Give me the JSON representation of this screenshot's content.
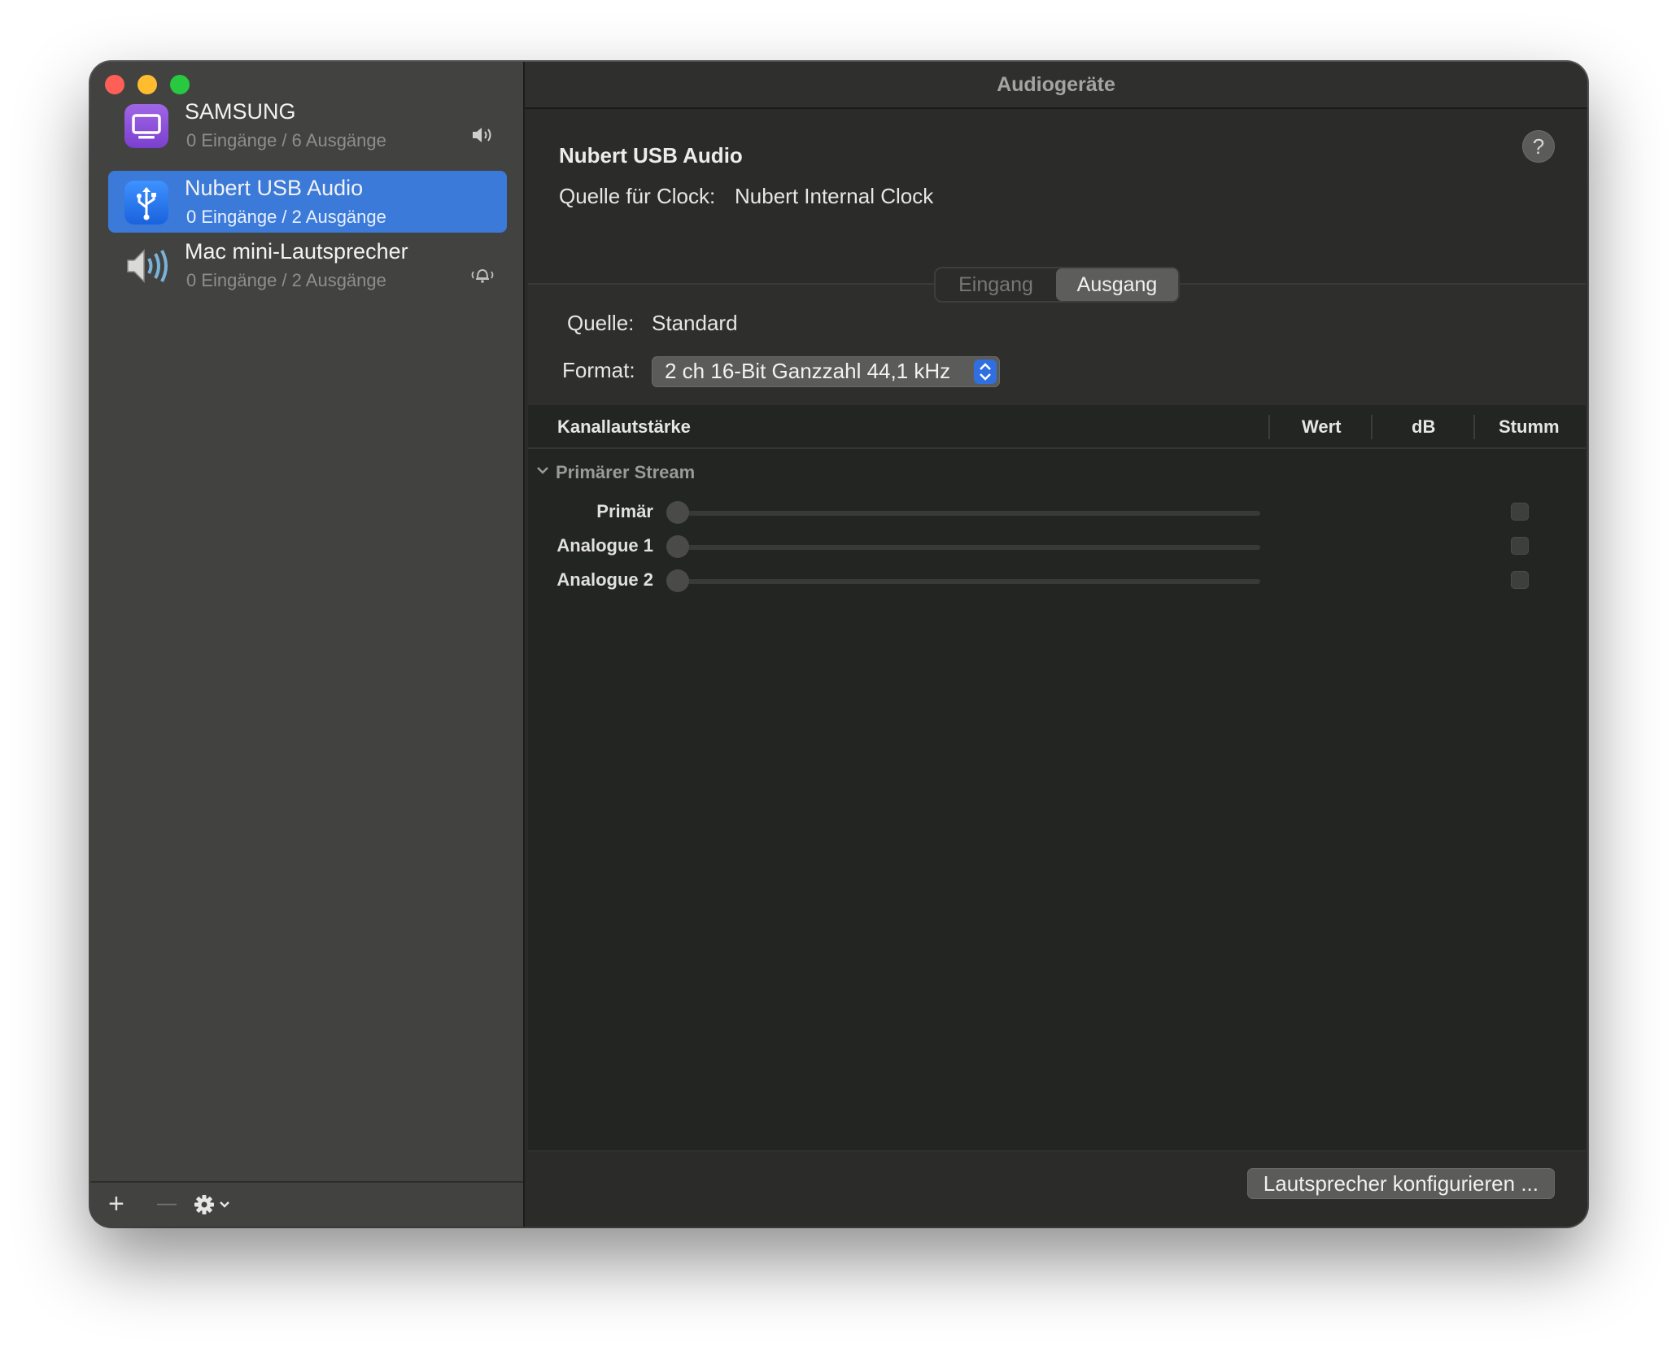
{
  "window": {
    "title": "Audiogeräte"
  },
  "sidebar": {
    "devices": [
      {
        "name": "SAMSUNG",
        "subtitle": "0 Eingänge / 6 Ausgänge",
        "icon": "display-icon",
        "status_icon": "speaker-icon",
        "selected": false
      },
      {
        "name": "Nubert USB Audio",
        "subtitle": "0 Eingänge / 2 Ausgänge",
        "icon": "usb-icon",
        "status_icon": "",
        "selected": true
      },
      {
        "name": "Mac mini-Lautsprecher",
        "subtitle": "0 Eingänge / 2 Ausgänge",
        "icon": "speaker-device-icon",
        "status_icon": "alert-bell-icon",
        "selected": false
      }
    ],
    "footer": {
      "add_label": "+",
      "remove_label": "—"
    }
  },
  "detail": {
    "device_name": "Nubert USB Audio",
    "clock_label": "Quelle für Clock:",
    "clock_value": "Nubert Internal Clock",
    "help_label": "?",
    "tabs": [
      {
        "label": "Eingang",
        "active": false
      },
      {
        "label": "Ausgang",
        "active": true
      }
    ],
    "source_label": "Quelle:",
    "source_value": "Standard",
    "format_label": "Format:",
    "format_value": "2 ch 16-Bit Ganzzahl 44,1 kHz",
    "table": {
      "columns": [
        "Kanallautstärke",
        "Wert",
        "dB",
        "Stumm"
      ],
      "group": "Primärer Stream",
      "channels": [
        {
          "name": "Primär",
          "level": 0,
          "muted": false
        },
        {
          "name": "Analogue 1",
          "level": 0,
          "muted": false
        },
        {
          "name": "Analogue 2",
          "level": 0,
          "muted": false
        }
      ]
    },
    "configure_button": "Lautsprecher konfigurieren ..."
  },
  "colors": {
    "accent": "#3b7ad9",
    "close": "#fe5f57",
    "minimize": "#febc2e",
    "maximize": "#28c840"
  }
}
